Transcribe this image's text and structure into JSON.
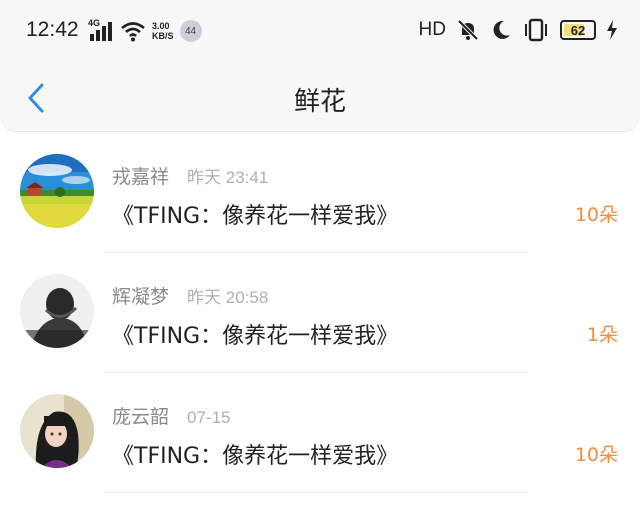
{
  "status_bar": {
    "time": "12:42",
    "network": "4G",
    "speed_value": "3.00",
    "speed_unit": "KB/S",
    "badge": "44",
    "hd": "HD",
    "battery": "62",
    "icons": [
      "signal-icon",
      "wifi-icon",
      "mute-icon",
      "moon-icon",
      "vibrate-icon",
      "battery-icon",
      "charging-icon"
    ]
  },
  "nav": {
    "back_icon": "chevron-left-icon",
    "title": "鲜花"
  },
  "colors": {
    "accent": "#2f8ff0",
    "count": "#f08c3c",
    "meta_text": "#8a8a8a"
  },
  "items": [
    {
      "name": "戎嘉祥",
      "time": "昨天 23:41",
      "gift": "《TFING：像养花一样爱我》",
      "count": "10朵",
      "avatar": "landscape"
    },
    {
      "name": "辉凝梦",
      "time": "昨天 20:58",
      "gift": "《TFING：像养花一样爱我》",
      "count": "1朵",
      "avatar": "monochrome-portrait"
    },
    {
      "name": "庞云韶",
      "time": "07-15",
      "gift": "《TFING：像养花一样爱我》",
      "count": "10朵",
      "avatar": "girl-portrait"
    }
  ]
}
